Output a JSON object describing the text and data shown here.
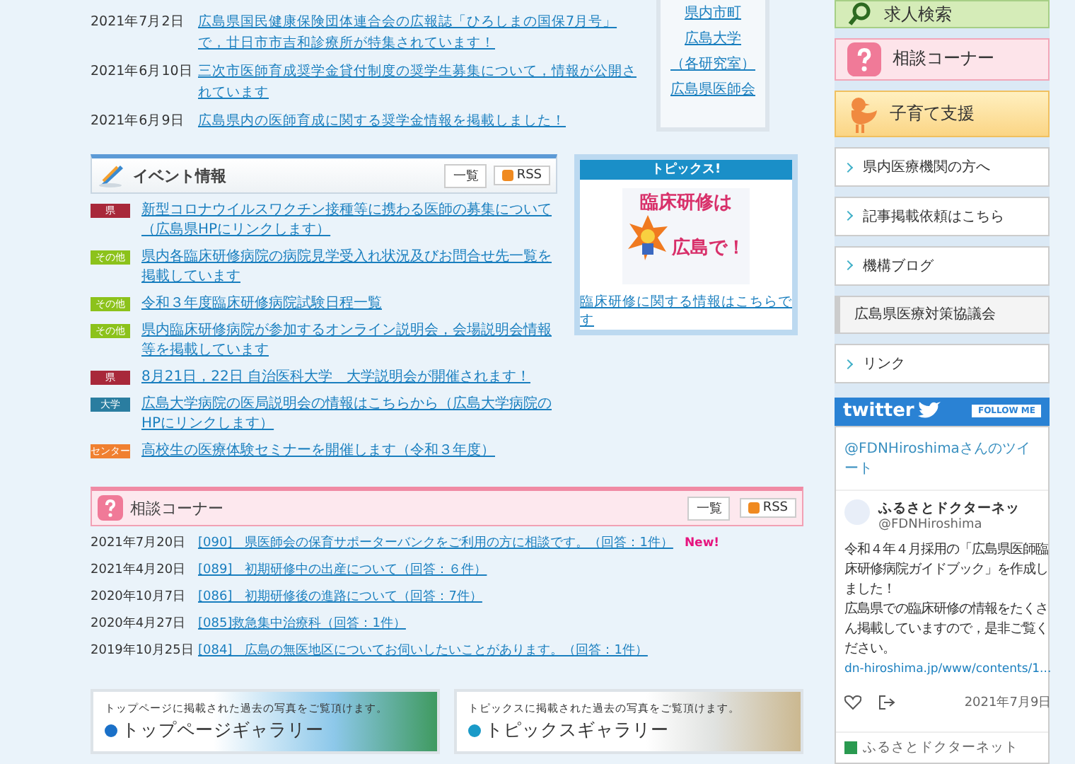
{
  "news": [
    {
      "date": "2021年7月2日",
      "text": "広島県国民健康保険団体連合会の広報誌「ひろしまの国保7月号」で，廿日市市吉和診療所が特集されています！"
    },
    {
      "date": "2021年6月10日",
      "text": "三次市医師育成奨学金貸付制度の奨学生募集について，情報が公開されています"
    },
    {
      "date": "2021年6月9日",
      "text": "広島県内の医師育成に関する奨学金情報を掲載しました！"
    }
  ],
  "links_box": [
    "県内市町",
    "広島大学",
    "（各研究室）",
    "広島県医師会"
  ],
  "events": {
    "title": "イベント情報",
    "list_button": "一覧",
    "rss_button": "RSS",
    "items": [
      {
        "tag": "県",
        "color": "#a8283a",
        "text": "新型コロナウイルスワクチン接種等に携わる医師の募集について（広島県HPにリンクします）"
      },
      {
        "tag": "その他",
        "color": "#8cc21b",
        "text": "県内各臨床研修病院の病院見学受入れ状況及びお問合せ先一覧を掲載しています"
      },
      {
        "tag": "その他",
        "color": "#8cc21b",
        "text": "令和３年度臨床研修病院試験日程一覧"
      },
      {
        "tag": "その他",
        "color": "#8cc21b",
        "text": "県内臨床研修病院が参加するオンライン説明会，会場説明会情報等を掲載しています"
      },
      {
        "tag": "県",
        "color": "#a8283a",
        "text": "8月21日，22日 自治医科大学　大学説明会が開催されます！"
      },
      {
        "tag": "大学",
        "color": "#2a7da0",
        "text": "広島大学病院の医局説明会の情報はこちらから（広島大学病院のHPにリンクします）"
      },
      {
        "tag": "センター",
        "color": "#f08030",
        "text": "高校生の医療体験セミナーを開催します（令和３年度）"
      }
    ]
  },
  "topics": {
    "title": "トピックス!",
    "banner_line_1": "臨床研修は",
    "banner_line_2": "広島で！",
    "link": "臨床研修に関する情報はこちらです"
  },
  "consult": {
    "title": "相談コーナー",
    "list_button": "一覧",
    "rss_button": "RSS",
    "items": [
      {
        "date": "2021年7月20日",
        "text": "[090]　県医師会の保育サポーターバンクをご利用の方に相談です。（回答：1件）",
        "badge": "New!"
      },
      {
        "date": "2021年4月20日",
        "text": "[089]　初期研修中の出産について（回答：６件）"
      },
      {
        "date": "2020年10月7日",
        "text": "[086]　初期研修後の進路について（回答：7件）"
      },
      {
        "date": "2020年4月27日",
        "text": "[085]救急集中治療科（回答：1件）"
      },
      {
        "date": "2019年10月25日",
        "text": "[084]　広島の無医地区についてお伺いしたいことがあります。（回答：1件）"
      }
    ]
  },
  "galleries": [
    {
      "kind": "sea",
      "caption": "トップページに掲載された過去の写真をご覧頂けます。",
      "title": "トップページギャラリー"
    },
    {
      "kind": "doctor",
      "caption": "トピックスに掲載された過去の写真をご覧頂けます。",
      "title": "トピックスギャラリー"
    }
  ],
  "sidebar": [
    {
      "kind": "search",
      "label": "求人検索"
    },
    {
      "kind": "consult",
      "label": "相談コーナー"
    },
    {
      "kind": "childcare",
      "label": "子育て支援"
    },
    {
      "kind": "link",
      "label": "県内医療機関の方へ"
    },
    {
      "kind": "link",
      "label": "記事掲載依頼はこちら"
    },
    {
      "kind": "link",
      "label": "機構ブログ"
    },
    {
      "kind": "council",
      "label": "広島県医療対策協議会"
    },
    {
      "kind": "link",
      "label": "リンク"
    }
  ],
  "twitter": {
    "logo": "twitter",
    "follow": "FOLLOW ME",
    "heading": "@FDNHiroshimaさんのツイート",
    "tweet": {
      "name": "ふるさとドクターネッ",
      "handle": "@FDNHiroshima",
      "text": [
        "令和４年４月採用の「広島県医師臨床研修病院ガイドブック」を作成しました！",
        "広島県での臨床研修の情報をたくさん掲載していますので，是非ご覧ください。"
      ],
      "link": "dn-hiroshima.jp/www/contents/1...",
      "date": "2021年7月9日"
    },
    "next_name": "ふるさとドクターネット"
  }
}
